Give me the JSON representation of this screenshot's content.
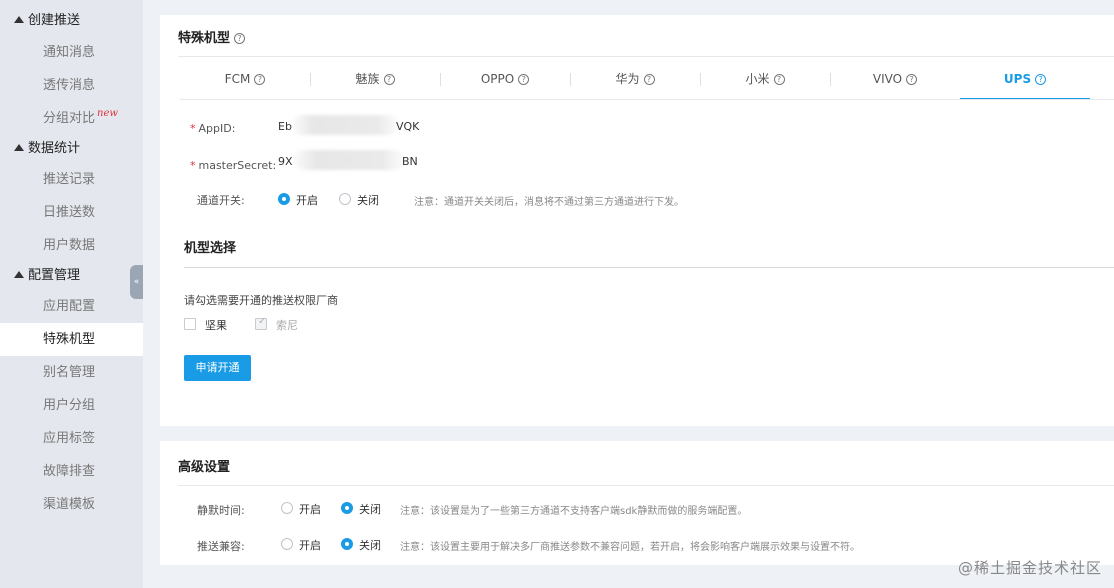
{
  "sidebar": {
    "groups": [
      {
        "label": "创建推送",
        "items": [
          {
            "label": "通知消息"
          },
          {
            "label": "透传消息"
          },
          {
            "label": "分组对比",
            "badge": "new"
          }
        ]
      },
      {
        "label": "数据统计",
        "items": [
          {
            "label": "推送记录"
          },
          {
            "label": "日推送数"
          },
          {
            "label": "用户数据"
          }
        ]
      },
      {
        "label": "配置管理",
        "items": [
          {
            "label": "应用配置"
          },
          {
            "label": "特殊机型"
          },
          {
            "label": "别名管理"
          },
          {
            "label": "用户分组"
          },
          {
            "label": "应用标签"
          },
          {
            "label": "故障排查"
          },
          {
            "label": "渠道模板"
          }
        ]
      }
    ],
    "active_item": "特殊机型",
    "collapse_glyph": "«"
  },
  "special": {
    "title": "特殊机型",
    "tabs": [
      {
        "label": "FCM"
      },
      {
        "label": "魅族"
      },
      {
        "label": "OPPO"
      },
      {
        "label": "华为"
      },
      {
        "label": "小米"
      },
      {
        "label": "VIVO"
      },
      {
        "label": "UPS"
      }
    ],
    "active_tab": "UPS",
    "appid": {
      "label": "AppID:",
      "prefix": "Eb",
      "suffix": "VQK"
    },
    "secret": {
      "label": "masterSecret:",
      "prefix": "9X",
      "suffix": "BN"
    },
    "channel": {
      "label": "通道开关:",
      "on": "开启",
      "off": "关闭",
      "selected": "开启",
      "note": "注意：通道开关关闭后，消息将不通过第三方通道进行下发。"
    },
    "model": {
      "title": "机型选择",
      "hint": "请勾选需要开通的推送权限厂商",
      "options": [
        {
          "label": "坚果",
          "checked": false,
          "disabled": false
        },
        {
          "label": "索尼",
          "checked": true,
          "disabled": true
        }
      ],
      "apply_button": "申请开通"
    }
  },
  "advanced": {
    "title": "高级设置",
    "rows": [
      {
        "label": "静默时间:",
        "on": "开启",
        "off": "关闭",
        "selected": "关闭",
        "note": "注意：该设置是为了一些第三方通道不支持客户端sdk静默而做的服务端配置。"
      },
      {
        "label": "推送兼容:",
        "on": "开启",
        "off": "关闭",
        "selected": "关闭",
        "note": "注意：该设置主要用于解决多厂商推送参数不兼容问题，若开启，将会影响客户端展示效果与设置不符。"
      }
    ]
  },
  "watermark": "@稀土掘金技术社区",
  "colors": {
    "accent": "#1a9be6",
    "sidebar_bg": "#e4e8ee",
    "page_bg": "#eef1f5",
    "required": "#e0303b"
  }
}
